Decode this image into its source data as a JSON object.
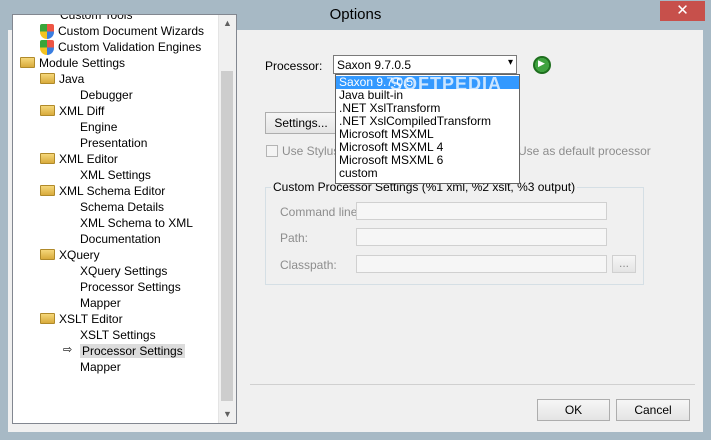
{
  "window": {
    "title": "Options",
    "close_glyph": "✕"
  },
  "tree": {
    "items": [
      {
        "label": "Custom Tools",
        "indent": 1,
        "icon": "none"
      },
      {
        "label": "Custom Document Wizards",
        "indent": 1,
        "icon": "shield"
      },
      {
        "label": "Custom Validation Engines",
        "indent": 1,
        "icon": "shield"
      },
      {
        "label": "Module Settings",
        "indent": 0,
        "icon": "folder"
      },
      {
        "label": "Java",
        "indent": 1,
        "icon": "folder"
      },
      {
        "label": "Debugger",
        "indent": 2,
        "icon": "none"
      },
      {
        "label": "XML Diff",
        "indent": 1,
        "icon": "folder"
      },
      {
        "label": "Engine",
        "indent": 2,
        "icon": "none"
      },
      {
        "label": "Presentation",
        "indent": 2,
        "icon": "none"
      },
      {
        "label": "XML Editor",
        "indent": 1,
        "icon": "folder"
      },
      {
        "label": "XML Settings",
        "indent": 2,
        "icon": "none"
      },
      {
        "label": "XML Schema Editor",
        "indent": 1,
        "icon": "folder"
      },
      {
        "label": "Schema Details",
        "indent": 2,
        "icon": "none"
      },
      {
        "label": "XML Schema to XML",
        "indent": 2,
        "icon": "none"
      },
      {
        "label": "Documentation",
        "indent": 2,
        "icon": "none"
      },
      {
        "label": "XQuery",
        "indent": 1,
        "icon": "folder"
      },
      {
        "label": "XQuery Settings",
        "indent": 2,
        "icon": "none"
      },
      {
        "label": "Processor Settings",
        "indent": 2,
        "icon": "none"
      },
      {
        "label": "Mapper",
        "indent": 2,
        "icon": "none"
      },
      {
        "label": "XSLT Editor",
        "indent": 1,
        "icon": "folder"
      },
      {
        "label": "XSLT Settings",
        "indent": 2,
        "icon": "none"
      },
      {
        "label": "Processor Settings",
        "indent": 2,
        "icon": "none",
        "selected": true
      },
      {
        "label": "Mapper",
        "indent": 2,
        "icon": "none"
      }
    ],
    "arrow_glyph": "⇨"
  },
  "processor": {
    "label": "Processor:",
    "selected": "Saxon 9.7.0.5",
    "options": [
      "Saxon 9.7.0.5",
      "Java built-in",
      ".NET XslTransform",
      ".NET XslCompiledTransform",
      "Microsoft MSXML",
      "Microsoft MSXML 4",
      "Microsoft MSXML 6",
      "custom"
    ]
  },
  "settings_button": "Settings...",
  "use_stylus": "Use Stylus",
  "use_default": "Use as default processor",
  "custom": {
    "title": "Custom Processor Settings (%1 xml, %2 xslt, %3 output)",
    "command_line": "Command line:",
    "path": "Path:",
    "classpath": "Classpath:",
    "browse": "..."
  },
  "watermark": "SOFTPEDIA",
  "ok": "OK",
  "cancel": "Cancel"
}
